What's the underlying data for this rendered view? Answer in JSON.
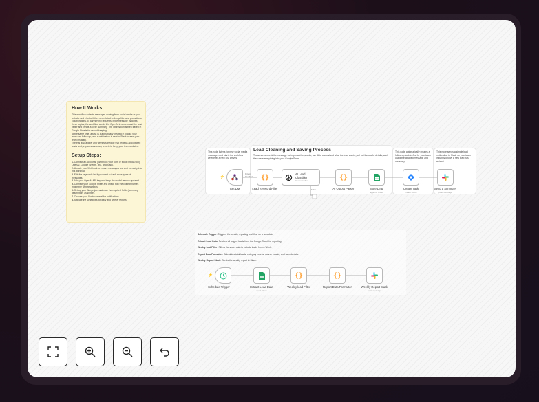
{
  "how_it_works": {
    "title": "How It Works:",
    "body": "This workflow collects messages coming from social media or your website and checks if they are related to things like ads, promotions, collaborations, or partnership requests. If the message matches these topics, the workflow sends it to OpenAI to understand the lead better and create a clear summary. The information is then saved in Google Sheets for record-keeping.\nAt the same time, a task is automatically created in Jira so your team can follow up, and a notification is sent to Slack to alert your team instantly.\nThere is also a daily and weekly schedule that reviews all collected leads and prepares summary reports to keep your team updated.",
    "setup_title": "Setup Steps:",
    "setup_steps": [
      {
        "num": "1.",
        "text": "Connect all accounts: (Webhook your form or social media tool), OpenAI, Google Sheets, Jira, and Slack."
      },
      {
        "num": "2.",
        "text": "Update your Webhook to ensure messages are sent correctly into this workflow."
      },
      {
        "num": "3.",
        "text": "Edit the keywords list if you want to track more types of messages."
      },
      {
        "num": "4.",
        "text": "Add your OpenAI API key and keep the model version updated."
      },
      {
        "num": "5.",
        "text": "Connect your Google Sheet and check that the column names match the workflow fields."
      },
      {
        "num": "6.",
        "text": "Set up your Jira project and map the required fields (summary, description, assignee)."
      },
      {
        "num": "7.",
        "text": "Choose your Slack channel for notifications."
      },
      {
        "num": "8.",
        "text": "Activate the schedules for daily and weekly reports."
      }
    ]
  },
  "lead_section": {
    "title": "Lead Cleaning and Saving Process",
    "subtitle": "These steps check the message for important keywords, use AI to understand what the lead wants, pull out the useful details, and then save everything into your Google Sheet.",
    "note_left": "This node listens for new social media messages and starts the workflow whenever a new DM arrives.",
    "note_jira": "This node automatically creates a follow-up task in Jira for your team using the cleaned message and summary.",
    "note_slack": "This node sends a simple lead notification to Slack so your team instantly knows a new lead has arrived.",
    "nodes": [
      {
        "label": "Get DM",
        "sub": "",
        "icon": "webhook-icon"
      },
      {
        "label": "Lead Keyword Filter",
        "sub": "",
        "icon": "code-icon"
      },
      {
        "label": "AI Lead Classifier",
        "sub": "Generate Text",
        "icon": "openai-icon"
      },
      {
        "label": "AI Output Parser",
        "sub": "",
        "icon": "code-icon"
      },
      {
        "label": "Store Lead",
        "sub": "append: sheet",
        "icon": "sheets-icon"
      },
      {
        "label": "Create Task",
        "sub": "create: issue",
        "icon": "jira-icon"
      },
      {
        "label": "Send a Summary",
        "sub": "post: message",
        "icon": "slack-icon"
      }
    ],
    "edge_labels": {
      "branch_true": "1 item\nhandled",
      "branch_false": "False"
    }
  },
  "weekly_section": {
    "notes": [
      {
        "bold": "Schedule Trigger:",
        "text": " Triggers the weekly reporting workflow on a schedule."
      },
      {
        "bold": "Extract Lead Data:",
        "text": " Fetches all logged leads from the Google Sheet for reporting."
      },
      {
        "bold": "Weekly lead Filter:",
        "text": " Filters the sheet data to include leads from a Week."
      },
      {
        "bold": "Report Data Formatter:",
        "text": " Calculates total leads, category counts, source counts, and sample data."
      },
      {
        "bold": "Weekly Report Slack:",
        "text": " Sends the weekly report to Slack."
      }
    ],
    "nodes": [
      {
        "label": "Schedule Trigger",
        "sub": "",
        "icon": "clock-icon"
      },
      {
        "label": "Extract Lead Data",
        "sub": "read: sheet",
        "icon": "sheets-icon"
      },
      {
        "label": "Weekly lead Filter",
        "sub": "",
        "icon": "code-icon"
      },
      {
        "label": "Report Data Formatter",
        "sub": "",
        "icon": "code-icon"
      },
      {
        "label": "Weekly Report Slack",
        "sub": "post: message",
        "icon": "slack-icon"
      }
    ]
  },
  "controls": [
    {
      "name": "fit-view-button",
      "icon": "fit-view-icon"
    },
    {
      "name": "zoom-in-button",
      "icon": "zoom-in-icon"
    },
    {
      "name": "zoom-out-button",
      "icon": "zoom-out-icon"
    },
    {
      "name": "undo-button",
      "icon": "undo-icon"
    }
  ],
  "colors": {
    "trigger_bolt": "#ff6d5a",
    "code_orange": "#ff9922",
    "sheets_green": "#21a464",
    "jira_blue": "#2684ff",
    "sticky_yellow": "#fdf6d6"
  }
}
